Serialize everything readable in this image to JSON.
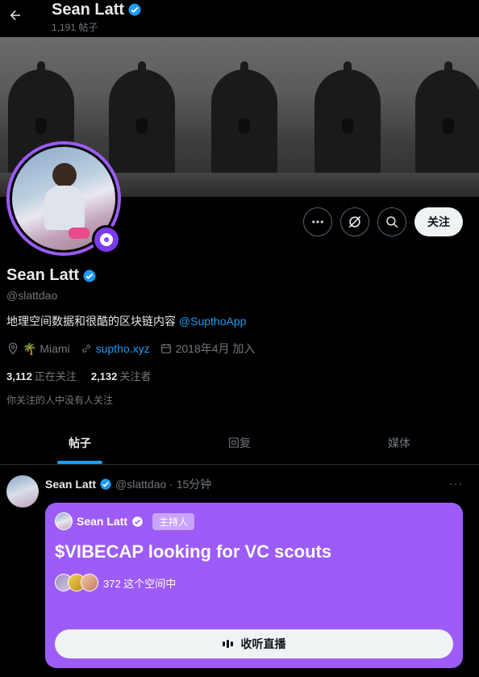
{
  "header": {
    "name": "Sean Latt",
    "posts_count": "1,191 帖子"
  },
  "actions": {
    "follow_label": "关注"
  },
  "profile": {
    "display_name": "Sean Latt",
    "handle": "@slattdao",
    "bio_text": "地理空间数据和很酷的区块链内容 ",
    "bio_mention": "@SupthoApp",
    "location": "🌴 Miami",
    "website": "suptho.xyz",
    "joined": "2018年4月 加入",
    "following_count": "3,112",
    "following_label": "正在关注",
    "followers_count": "2,132",
    "followers_label": "关注者",
    "followed_by_note": "你关注的人中没有人关注"
  },
  "tabs": [
    "帖子",
    "回复",
    "媒体"
  ],
  "post": {
    "author_name": "Sean Latt",
    "meta": "@slattdao · 15分钟",
    "space": {
      "host_name": "Sean Latt",
      "host_tag": "主持人",
      "title": "$VIBECAP looking for VC scouts",
      "listeners": "372 这个空间中",
      "listen_label": "收听直播"
    }
  },
  "colors": {
    "accent": "#1d9bf0",
    "space_card": "#9d5cf7",
    "avatar_ring": "#9b5cf6"
  }
}
